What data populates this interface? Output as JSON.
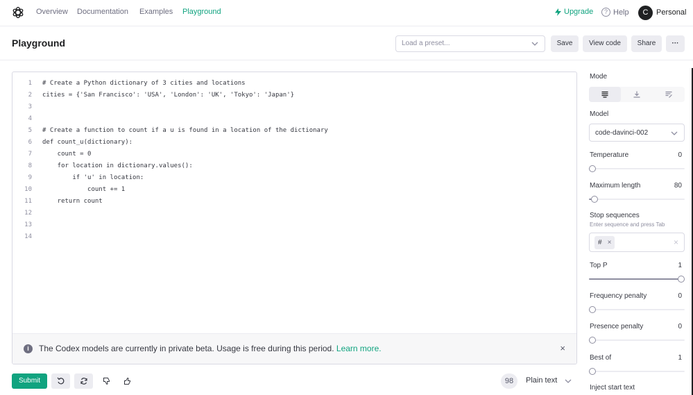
{
  "nav": {
    "links": [
      "Overview",
      "Documentation",
      "Examples",
      "Playground"
    ],
    "active": "Playground",
    "upgrade": "Upgrade",
    "help": "Help",
    "avatar_letter": "C",
    "account": "Personal"
  },
  "header": {
    "title": "Playground",
    "preset_placeholder": "Load a preset...",
    "save": "Save",
    "view_code": "View code",
    "share": "Share",
    "more": "···"
  },
  "editor": {
    "lines": [
      {
        "n": "1",
        "text": "# Create a Python dictionary of 3 cities and locations"
      },
      {
        "n": "2",
        "text": "cities = {'San Francisco': 'USA', 'London': 'UK', 'Tokyo': 'Japan'}"
      },
      {
        "n": "3",
        "text": ""
      },
      {
        "n": "4",
        "text": ""
      },
      {
        "n": "5",
        "text": "# Create a function to count if a u is found in a location of the dictionary"
      },
      {
        "n": "6",
        "text": "def count_u(dictionary):"
      },
      {
        "n": "7",
        "text": "    count = 0"
      },
      {
        "n": "8",
        "text": "    for location in dictionary.values():"
      },
      {
        "n": "9",
        "text": "        if 'u' in location:"
      },
      {
        "n": "10",
        "text": "            count += 1"
      },
      {
        "n": "11",
        "text": "    return count"
      },
      {
        "n": "12",
        "text": ""
      },
      {
        "n": "13",
        "text": ""
      },
      {
        "n": "14",
        "text": ""
      }
    ],
    "banner_text": "The Codex models are currently in private beta. Usage is free during this period.",
    "banner_link": "Learn more.",
    "banner_close": "×"
  },
  "bottom": {
    "submit": "Submit",
    "token_count": "98",
    "format": "Plain text"
  },
  "sidebar": {
    "mode_label": "Mode",
    "mode_active": "complete",
    "model_label": "Model",
    "model_value": "code-davinci-002",
    "temperature": {
      "label": "Temperature",
      "value": "0",
      "fraction": 0
    },
    "max_length": {
      "label": "Maximum length",
      "value": "80",
      "fraction": 0.02
    },
    "stop": {
      "label": "Stop sequences",
      "hint": "Enter sequence and press Tab",
      "chip": "#",
      "chip_remove": "×",
      "clear": "×"
    },
    "top_p": {
      "label": "Top P",
      "value": "1",
      "fraction": 1
    },
    "frequency_penalty": {
      "label": "Frequency penalty",
      "value": "0",
      "fraction": 0
    },
    "presence_penalty": {
      "label": "Presence penalty",
      "value": "0",
      "fraction": 0
    },
    "best_of": {
      "label": "Best of",
      "value": "1",
      "fraction": 0
    },
    "inject_start": {
      "label": "Inject start text"
    }
  },
  "colors": {
    "accent": "#10a37f",
    "text": "#202123",
    "muted": "#6e6e80",
    "border": "#d9d9e3",
    "chip": "#ececf1"
  }
}
